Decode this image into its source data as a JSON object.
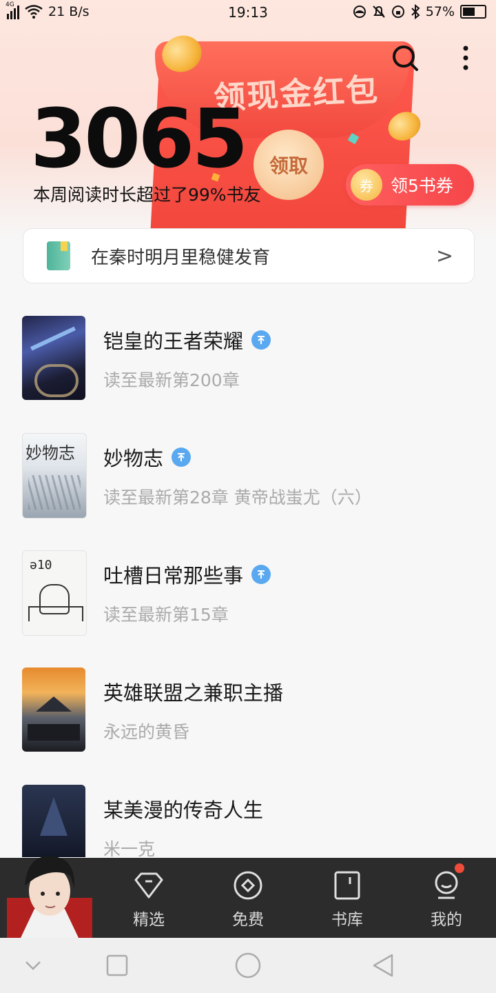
{
  "status_bar": {
    "network": "4G",
    "speed": "21 B/s",
    "time": "19:13",
    "battery": "57%"
  },
  "hero": {
    "reading_minutes": "3065",
    "reading_desc": "本周阅读时长超过了99%书友",
    "envelope_title": "领现金红包",
    "envelope_button": "领取",
    "coupon_badge": "券",
    "coupon_label": "领5书券"
  },
  "banner": {
    "text": "在秦时明月里稳健发育",
    "chevron": ">"
  },
  "books": [
    {
      "title": "铠皇的王者荣耀",
      "subtitle": "读至最新第200章",
      "updated": true
    },
    {
      "title": "妙物志",
      "subtitle": "读至最新第28章 黄帝战蚩尤（六）",
      "updated": true
    },
    {
      "title": "吐槽日常那些事",
      "subtitle": "读至最新第15章",
      "updated": true
    },
    {
      "title": "英雄联盟之兼职主播",
      "subtitle": "永远的黄昏",
      "updated": false
    },
    {
      "title": "某美漫的传奇人生",
      "subtitle": "米一克",
      "updated": false
    }
  ],
  "tabs": [
    {
      "label": "精选",
      "icon": "diamond-icon"
    },
    {
      "label": "免费",
      "icon": "circle-target-icon"
    },
    {
      "label": "书库",
      "icon": "bookshelf-icon"
    },
    {
      "label": "我的",
      "icon": "user-face-icon"
    }
  ],
  "colors": {
    "accent_red": "#f1453b",
    "update_blue": "#5aa8f0",
    "tabbar_bg": "#2c2c2c"
  }
}
